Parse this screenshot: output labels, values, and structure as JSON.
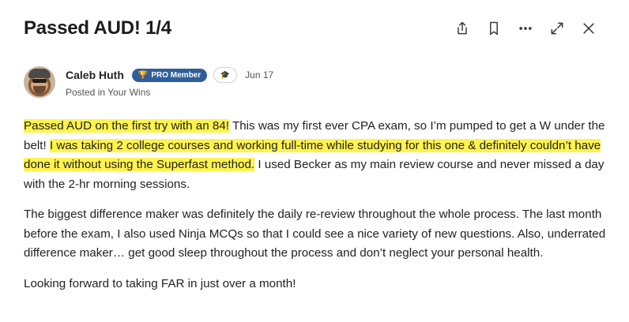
{
  "post": {
    "title": "Passed AUD! 1/4",
    "author": {
      "name": "Caleb Huth",
      "badge": "PRO Member",
      "date": "Jun 17",
      "posted_in": "Posted in Your Wins"
    },
    "paragraphs": [
      {
        "hl1": "Passed AUD on the first try with an 84!",
        "t1": " This was my first ever CPA exam, so I’m pumped to get a W under the belt! ",
        "hl2": "I was taking 2 college courses and working full-time while studying for this one & definitely couldn’t have done it without using the Superfast method.",
        "t2": " I used Becker as my main review course and never missed a day with the 2-hr morning sessions."
      },
      {
        "text": "The biggest difference maker was definitely the daily re-review throughout the whole process. The last month before the exam, I also used Ninja MCQs so that I could see a nice variety of new questions. Also, underrated difference maker… get good sleep throughout the process and don’t neglect your personal health."
      },
      {
        "text": "Looking forward to taking FAR in just over a month!"
      }
    ]
  },
  "icons": {
    "share": "share-icon",
    "bookmark": "bookmark-icon",
    "more": "more-icon",
    "expand": "expand-icon",
    "close": "close-icon"
  },
  "colors": {
    "highlight": "#fff34d",
    "badge": "#2e5e9c"
  }
}
